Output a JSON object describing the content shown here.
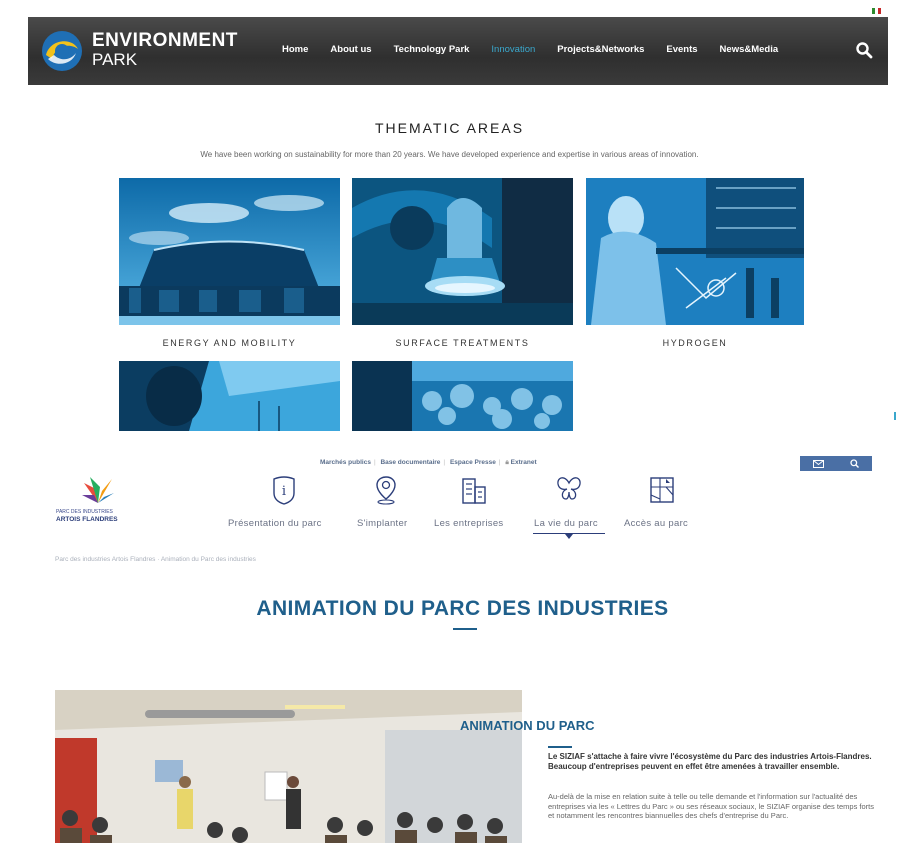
{
  "env_park": {
    "brand_line1": "ENVIRONMENT",
    "brand_line2": "PARK",
    "nav": [
      "Home",
      "About us",
      "Technology Park",
      "Innovation",
      "Projects&Networks",
      "Events",
      "News&Media"
    ],
    "active_nav": "Innovation",
    "colors": {
      "header": "#3a3a3a",
      "active": "#3aa7cc",
      "logo_blue": "#1f6fb5",
      "logo_yellow": "#f2c21b"
    }
  },
  "thematic": {
    "title": "THEMATIC AREAS",
    "subtitle": "We have been working on sustainability for more than 20 years. We have developed experience and expertise in various areas of innovation.",
    "tiles": [
      {
        "label": "ENERGY AND MOBILITY"
      },
      {
        "label": "SURFACE TREATMENTS"
      },
      {
        "label": "HYDROGEN"
      },
      {
        "label": ""
      },
      {
        "label": ""
      }
    ]
  },
  "pdi": {
    "top_links": [
      "Marchés publics",
      "Base documentaire",
      "Espace Presse",
      "Extranet"
    ],
    "logo_line1": "PARC DES INDUSTRIES",
    "logo_line2": "ARTOIS FLANDRES",
    "nav": [
      {
        "label": "Présentation du parc",
        "icon": "info-icon"
      },
      {
        "label": "S'implanter",
        "icon": "map-pin-icon"
      },
      {
        "label": "Les entreprises",
        "icon": "buildings-icon"
      },
      {
        "label": "La vie du parc",
        "icon": "butterfly-icon"
      },
      {
        "label": "Accès au parc",
        "icon": "map-icon"
      }
    ],
    "active_nav": "La vie du parc",
    "breadcrumb": "Parc des industries Artois Flandres · Animation du Parc des industries",
    "main_title": "ANIMATION DU PARC DES INDUSTRIES",
    "section_title": "ANIMATION DU PARC",
    "lead": "Le SIZIAF s'attache à faire vivre l'écosystème du Parc des industries Artois-Flandres. Beaucoup d'entreprises peuvent en effet être amenées à travailler ensemble.",
    "body": "Au-delà de la mise en relation suite à telle ou telle demande et l'information sur l'actualité des entreprises via les « Lettres du Parc » ou ses réseaux sociaux, le SIZIAF organise des temps forts et notamment les rencontres biannuelles des chefs d'entreprise du Parc.",
    "colors": {
      "title": "#1f5f8b",
      "nav_text": "#6b7285",
      "buttons": "#4a6fa5"
    }
  }
}
